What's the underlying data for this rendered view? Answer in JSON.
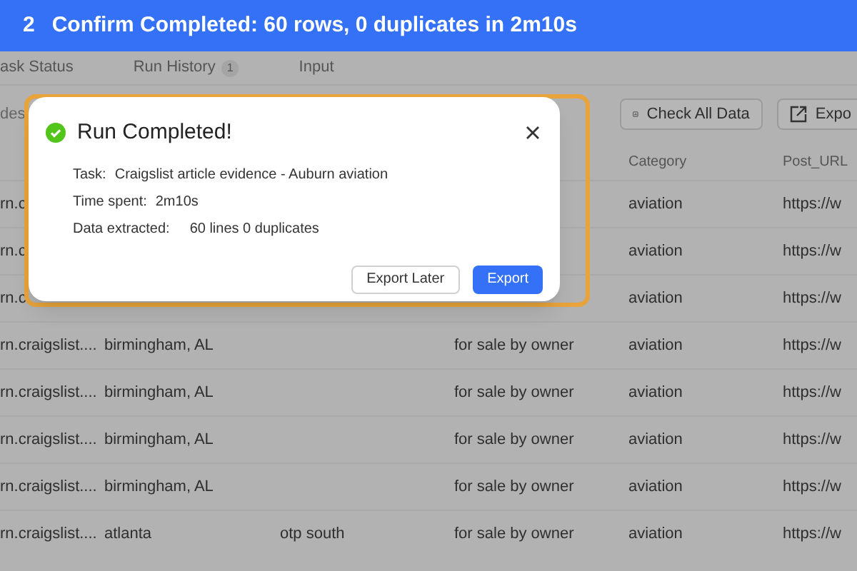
{
  "banner": {
    "step": "2",
    "title": "Confirm Completed: 60 rows, 0 duplicates in 2m10s"
  },
  "tabs": [
    {
      "label": "ask Status"
    },
    {
      "label": "Run History",
      "badge": "1"
    },
    {
      "label": "Input"
    }
  ],
  "toolbar": {
    "left_text": "des",
    "buttons": [
      {
        "label": "Check All Data",
        "kind": "chart"
      },
      {
        "label": "Expo",
        "kind": "export"
      }
    ]
  },
  "table": {
    "columns": [
      "",
      "",
      "",
      "",
      "Category",
      "Post_URL"
    ],
    "rows": [
      [
        "rn.c",
        "",
        "",
        "",
        "aviation",
        "https://w"
      ],
      [
        "rn.c",
        "",
        "",
        "",
        "aviation",
        "https://w"
      ],
      [
        "rn.c",
        "",
        "",
        "",
        "aviation",
        "https://w"
      ],
      [
        "rn.craigslist....",
        "birmingham, AL",
        "",
        "for sale by owner",
        "aviation",
        "https://w"
      ],
      [
        "rn.craigslist....",
        "birmingham, AL",
        "",
        "for sale by owner",
        "aviation",
        "https://w"
      ],
      [
        "rn.craigslist....",
        "birmingham, AL",
        "",
        "for sale by owner",
        "aviation",
        "https://w"
      ],
      [
        "rn.craigslist....",
        "birmingham, AL",
        "",
        "for sale by owner",
        "aviation",
        "https://w"
      ],
      [
        "rn.craigslist....",
        "atlanta",
        "otp south",
        "for sale by owner",
        "aviation",
        "https://w"
      ]
    ]
  },
  "dialog": {
    "title": "Run Completed!",
    "details": [
      {
        "label": "Task:",
        "value": "Craigslist article evidence - Auburn aviation"
      },
      {
        "label": "Time spent:",
        "value": "2m10s"
      },
      {
        "label": "Data extracted:",
        "value": "60 lines 0 duplicates"
      }
    ],
    "buttons": [
      {
        "label": "Export Later",
        "kind": "secondary"
      },
      {
        "label": "Export",
        "kind": "primary"
      }
    ]
  }
}
